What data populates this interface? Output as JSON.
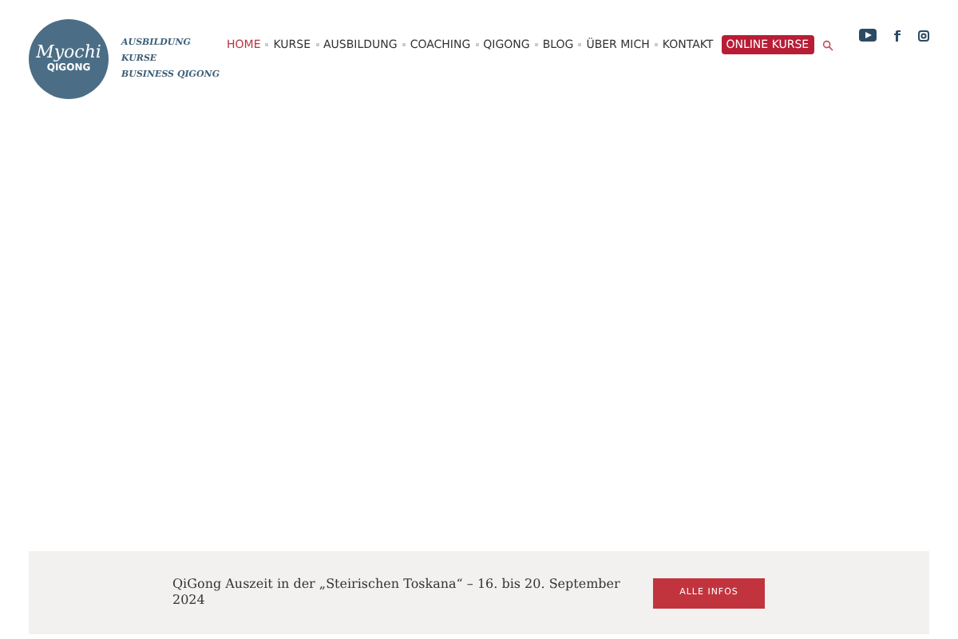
{
  "logo": {
    "script": "Myochi",
    "word": "QIGONG"
  },
  "taglines": [
    "AUSBILDUNG",
    "KURSE",
    "BUSINESS QIGONG"
  ],
  "nav": [
    {
      "label": "HOME",
      "selected": true
    },
    {
      "label": "KURSE",
      "selected": false
    },
    {
      "label": "AUSBILDUNG",
      "selected": false
    },
    {
      "label": "COACHING",
      "selected": false
    },
    {
      "label": "QIGONG",
      "selected": false
    },
    {
      "label": "BLOG",
      "selected": false
    },
    {
      "label": "ÜBER MICH",
      "selected": false
    },
    {
      "label": "KONTAKT",
      "selected": false
    }
  ],
  "cta": "ONLINE KURSE",
  "social": [
    {
      "kind": "youtube"
    },
    {
      "kind": "facebook"
    },
    {
      "kind": "instagram"
    }
  ],
  "banner": {
    "text": "QiGong Auszeit in der „Steirischen Toskana“ – 16. bis 20. September 2024",
    "button": "ALLE INFOS"
  }
}
